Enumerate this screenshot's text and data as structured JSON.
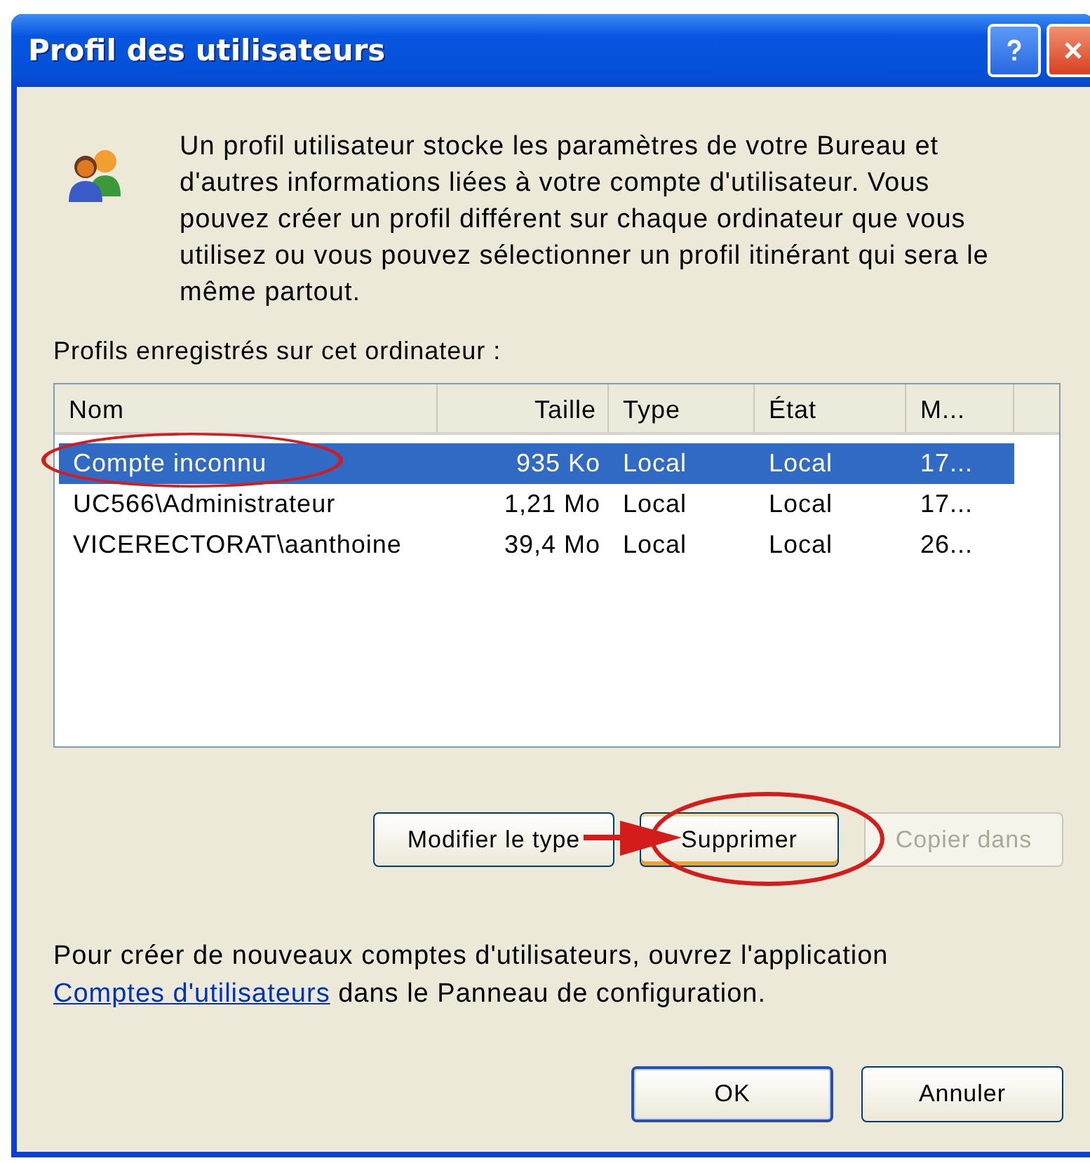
{
  "window": {
    "title": "Profil des utilisateurs"
  },
  "intro": "Un profil utilisateur stocke les paramètres de votre Bureau et d'autres informations liées à votre compte d'utilisateur. Vous pouvez créer un profil différent sur chaque ordinateur que vous utilisez ou vous pouvez sélectionner un profil itinérant qui sera le même partout.",
  "list_label": "Profils enregistrés sur cet ordinateur :",
  "table": {
    "columns": [
      "Nom",
      "Taille",
      "Type",
      "État",
      "M..."
    ],
    "rows": [
      {
        "cells": [
          "Compte inconnu",
          "935 Ko",
          "Local",
          "Local",
          "17..."
        ],
        "selected": true
      },
      {
        "cells": [
          "UC566\\Administrateur",
          "1,21 Mo",
          "Local",
          "Local",
          "17..."
        ],
        "selected": false
      },
      {
        "cells": [
          "VICERECTORAT\\aanthoine",
          "39,4 Mo",
          "Local",
          "Local",
          "26..."
        ],
        "selected": false
      }
    ]
  },
  "actions": [
    {
      "label": "Modifier le type",
      "disabled": false,
      "focused": false
    },
    {
      "label": "Supprimer",
      "disabled": false,
      "focused": true
    },
    {
      "label": "Copier dans",
      "disabled": true,
      "focused": false
    }
  ],
  "footer": {
    "before": "Pour créer de nouveaux comptes d'utilisateurs, ouvrez l'application",
    "link": "Comptes d'utilisateurs",
    "after": "dans le Panneau de configuration."
  },
  "buttons": [
    {
      "label": "OK",
      "default": true
    },
    {
      "label": "Annuler",
      "default": false
    }
  ]
}
